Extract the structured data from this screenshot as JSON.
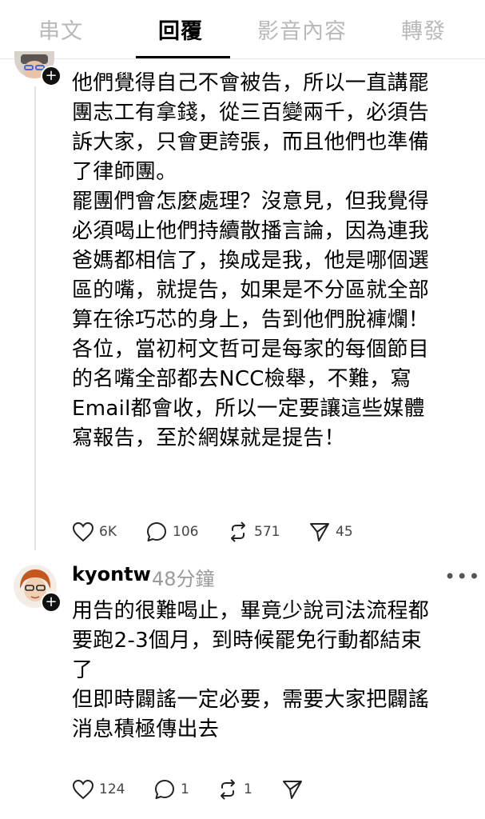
{
  "tabs": [
    {
      "label": "串文",
      "active": false
    },
    {
      "label": "回覆",
      "active": true
    },
    {
      "label": "影音內容",
      "active": false
    },
    {
      "label": "轉發",
      "active": false
    }
  ],
  "post1": {
    "text": "他們覺得自己不會被告，所以一直講罷\n團志工有拿錢，從三百變兩千，必須告\n訴大家，只會更誇張，而且他們也準備\n了律師團。\n罷團們會怎麼處理？沒意見，但我覺得\n必須喝止他們持續散播言論，因為連我\n爸媽都相信了，換成是我，他是哪個選\n區的嘴，就提告，如果是不分區就全部\n算在徐巧芯的身上，告到他們脫褲爛！\n各位，當初柯文哲可是每家的每個節目\n的名嘴全部都去NCC檢舉，不難，寫\nEmail都會收，所以一定要讓這些媒體\n寫報告，至於網媒就是提告！",
    "likes": "6K",
    "replies": "106",
    "reposts": "571",
    "shares": "45"
  },
  "post2": {
    "username": "kyontw",
    "time": "48分鐘",
    "more": "•••",
    "text": "用告的很難喝止，畢竟少說司法流程都\n要跑2-3個月，到時候罷免行動都結束\n了\n但即時闢謠一定必要，需要大家把闢謠\n消息積極傳出去",
    "likes": "124",
    "replies": "1",
    "reposts": "1"
  },
  "icons": {
    "like": "heart-icon",
    "reply": "speech-bubble-icon",
    "repost": "repost-icon",
    "share": "send-icon",
    "follow": "plus-icon"
  },
  "colors": {
    "active_tab": "#000000",
    "inactive_tab": "#b9b9b9",
    "timestamp": "#9a9a9a",
    "thread_line": "#e3e3e3"
  }
}
